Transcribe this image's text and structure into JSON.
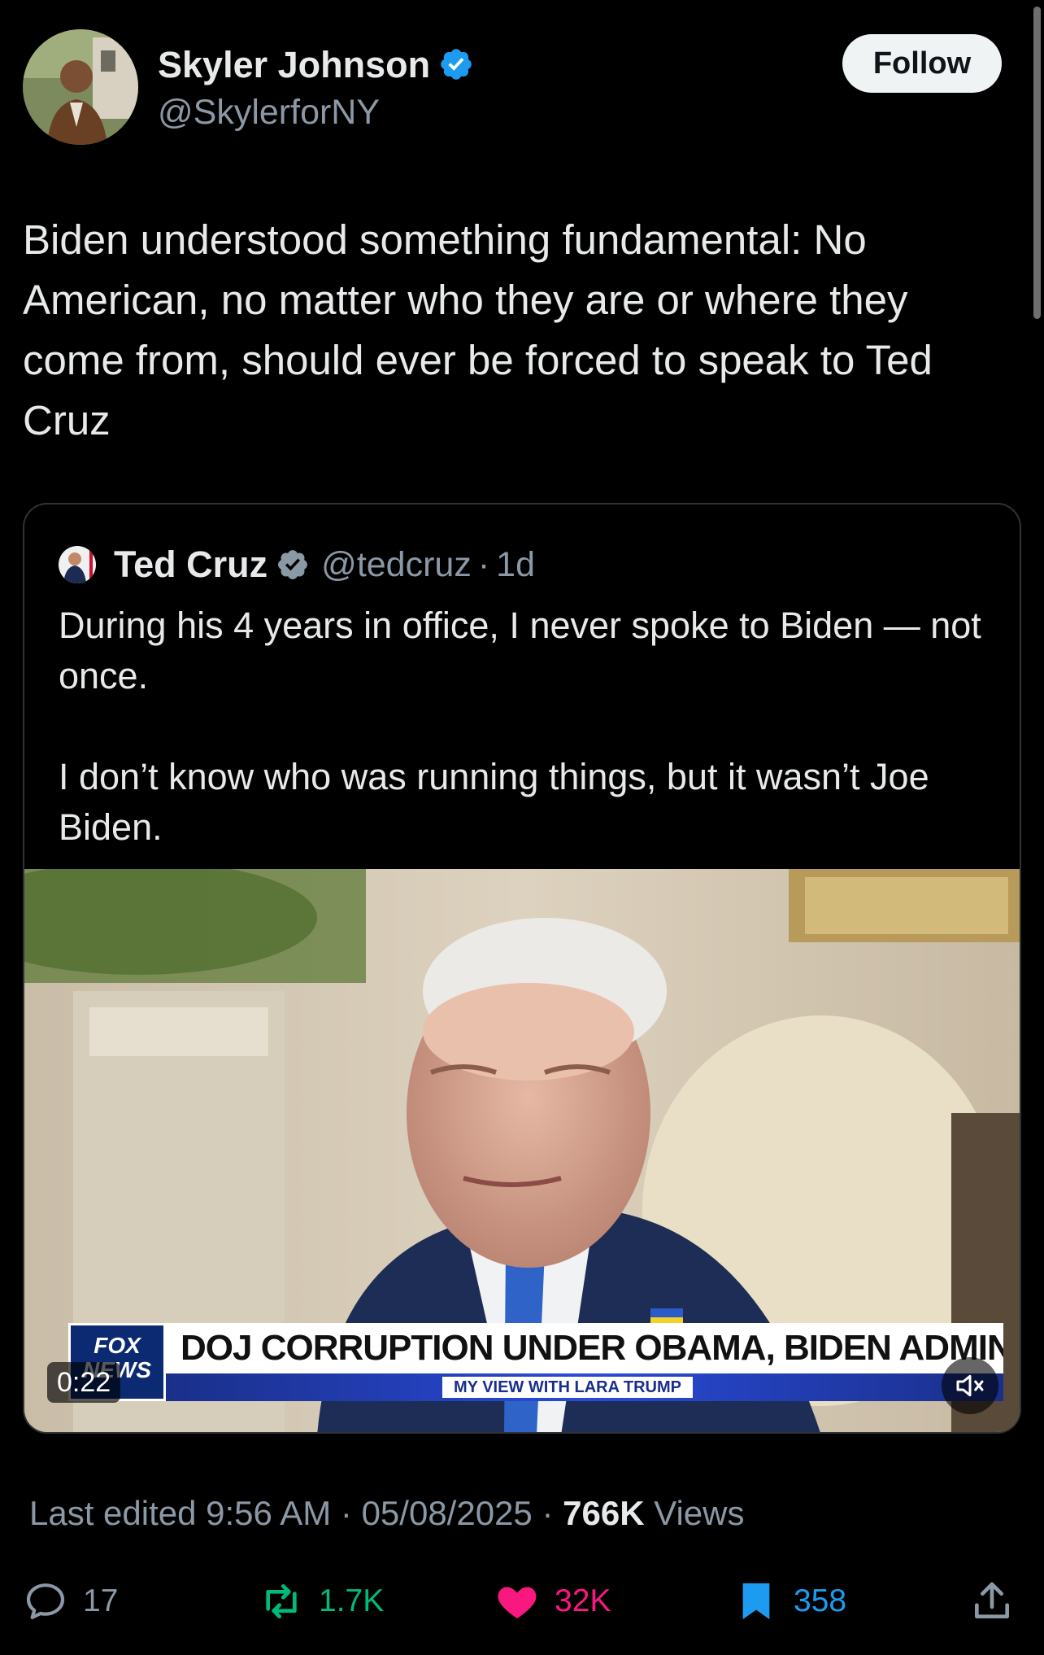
{
  "tweet": {
    "author_name": "Skyler Johnson",
    "author_handle": "@SkylerforNY",
    "follow_label": "Follow",
    "text": "Biden understood something fundamental: No American, no matter who they are or where they come from, should ever be forced to speak to Ted Cruz"
  },
  "quote": {
    "author_name": "Ted Cruz",
    "author_handle": "@tedcruz",
    "separator": "·",
    "time": "1d",
    "text": "During his 4 years in office, I never spoke to Biden — not once.\n\nI don’t know who was running things, but it wasn’t Joe Biden.",
    "media": {
      "chyron_logo": "FOX NEWS",
      "chyron_headline": "DOJ CORRUPTION UNDER OBAMA, BIDEN ADMINS",
      "chyron_subline": "MY VIEW WITH LARA TRUMP",
      "duration": "0:22"
    }
  },
  "meta": {
    "edited_label": "Last edited 9:56 AM · 05/08/2025",
    "separator": "·",
    "views_count": "766K",
    "views_label": "Views"
  },
  "actions": {
    "replies": "17",
    "reposts": "1.7K",
    "likes": "32K",
    "bookmarks": "358"
  },
  "colors": {
    "background": "#000000",
    "verified": "#1d9bf0",
    "repost": "#00ba7c",
    "like": "#f91880",
    "bookmark": "#1d9bf0",
    "muted_text": "#8b98a5"
  },
  "icons": [
    "verified-badge-icon",
    "reply-icon",
    "repost-icon",
    "like-icon",
    "bookmark-icon",
    "share-icon",
    "mute-icon"
  ]
}
